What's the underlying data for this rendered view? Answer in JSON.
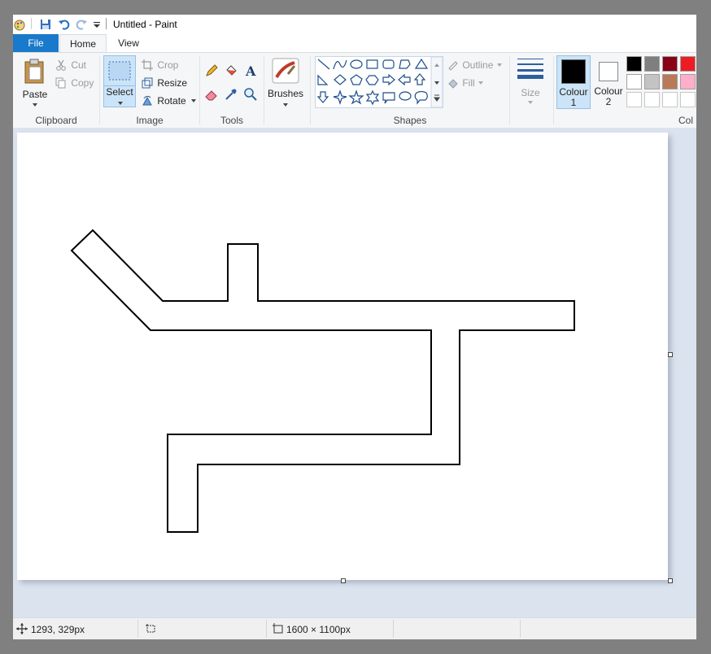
{
  "window": {
    "title": "Untitled - Paint"
  },
  "tabs": {
    "file": "File",
    "home": "Home",
    "view": "View"
  },
  "clipboard": {
    "paste": "Paste",
    "cut": "Cut",
    "copy": "Copy",
    "group": "Clipboard"
  },
  "image": {
    "select": "Select",
    "crop": "Crop",
    "resize": "Resize",
    "rotate": "Rotate",
    "group": "Image"
  },
  "tools": {
    "group": "Tools"
  },
  "brushes": {
    "label": "Brushes"
  },
  "shapes": {
    "outline": "Outline",
    "fill": "Fill",
    "group": "Shapes"
  },
  "size": {
    "label": "Size"
  },
  "colours": {
    "colour1": "Colour 1",
    "colour1_line1": "Colour",
    "colour1_line2": "1",
    "colour2": "Colour 2",
    "colour2_line1": "Colour",
    "colour2_line2": "2",
    "group": "Col",
    "colour1_value": "#000000",
    "colour2_value": "#ffffff",
    "palette_row1": [
      "#000000",
      "#7f7f7f",
      "#880015",
      "#ed1c24"
    ],
    "palette_row2": [
      "#ffffff",
      "#c3c3c3",
      "#b97a57",
      "#ffaec9"
    ],
    "palette_row3": [
      "#ffffff",
      "#ffffff",
      "#ffffff",
      "#ffffff"
    ]
  },
  "status": {
    "cursor_pos": "1293, 329px",
    "canvas_size": "1600 × 1100px"
  }
}
